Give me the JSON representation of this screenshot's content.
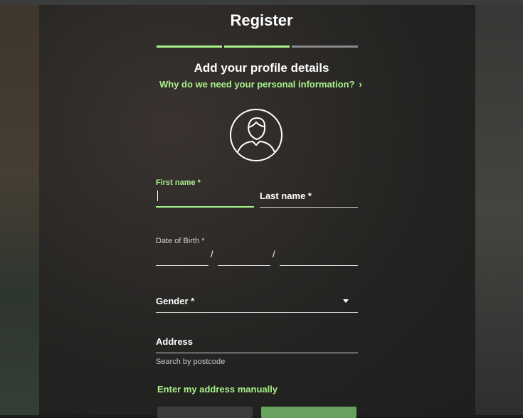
{
  "page": {
    "title": "Register",
    "subtitle": "Add your profile details",
    "why_link": "Why do we need your personal information?",
    "progress_steps": [
      {
        "state": "complete",
        "color": "#a7f28a"
      },
      {
        "state": "complete",
        "color": "#a7f28a"
      },
      {
        "state": "pending",
        "color": "#8a8a8a"
      }
    ]
  },
  "form": {
    "first_name": {
      "label": "First name *",
      "value": ""
    },
    "last_name": {
      "label": "Last name *",
      "value": ""
    },
    "dob": {
      "label": "Date of Birth *",
      "separator": "/"
    },
    "gender": {
      "label": "Gender *",
      "value": ""
    },
    "address": {
      "label": "Address",
      "hint": "Search by postcode"
    },
    "manual_link": "Enter my address manually"
  },
  "buttons": {
    "back_label": "",
    "next_label": ""
  },
  "icons": {
    "avatar": "user-avatar-icon",
    "why_chevron": "chevron-right-icon",
    "gender_dropdown": "caret-down-icon"
  },
  "colors": {
    "accent": "#a7f28a",
    "text": "#ffffff",
    "inactive_line": "#d8d8d8"
  }
}
